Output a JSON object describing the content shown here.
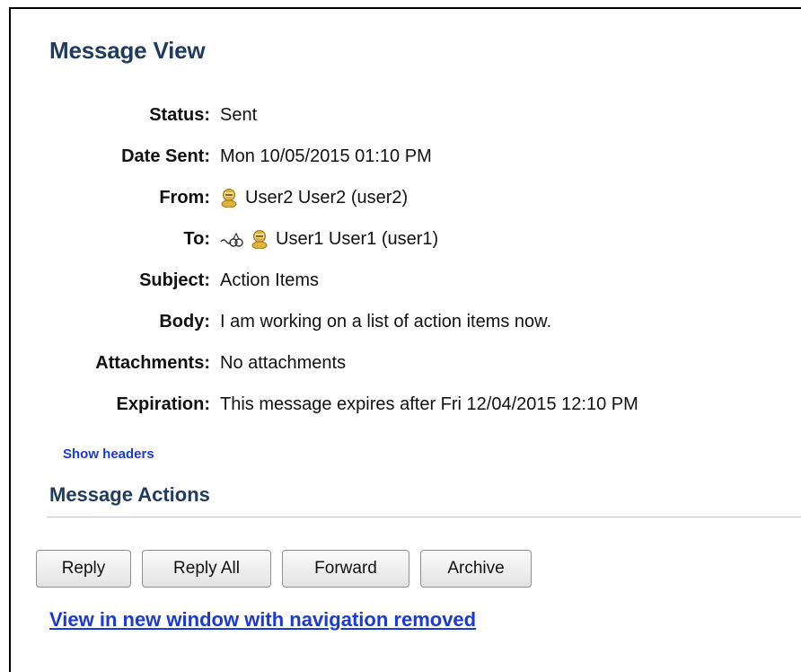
{
  "title": "Message View",
  "fields": {
    "status": {
      "label": "Status:",
      "value": "Sent"
    },
    "date_sent": {
      "label": "Date Sent:",
      "value": "Mon 10/05/2015 01:10 PM"
    },
    "from": {
      "label": "From:",
      "value": "User2 User2 (user2)",
      "icon": "user-icon"
    },
    "to": {
      "label": "To:",
      "value": "User1 User1 (user1)",
      "icons": [
        "link-icon",
        "user-icon"
      ]
    },
    "subject": {
      "label": "Subject:",
      "value": "Action Items"
    },
    "body": {
      "label": "Body:",
      "value": "I am working on a list of action items now."
    },
    "attachments": {
      "label": "Attachments:",
      "value": "No attachments"
    },
    "expiration": {
      "label": "Expiration:",
      "value": "This message expires after Fri 12/04/2015 12:10 PM"
    }
  },
  "show_headers": "Show headers",
  "actions": {
    "section_title": "Message Actions",
    "reply": "Reply",
    "reply_all": "Reply All",
    "forward": "Forward",
    "archive": "Archive"
  },
  "view_new_window": "View in new window with navigation removed",
  "colors": {
    "heading": "#1f3b5f",
    "link": "#1a3ad6",
    "user_icon": "#e0b43a"
  }
}
